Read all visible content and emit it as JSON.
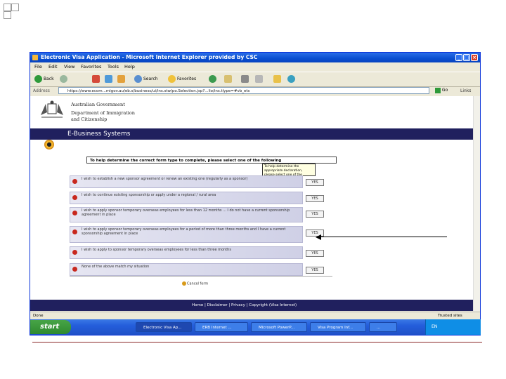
{
  "window": {
    "title": "Electronic Visa Application - Microsoft Internet Explorer provided by CSC"
  },
  "menu": {
    "items": [
      "File",
      "Edit",
      "View",
      "Favorites",
      "Tools",
      "Help"
    ]
  },
  "toolbar": {
    "back": "Back",
    "search": "Search",
    "favorites": "Favorites"
  },
  "address": {
    "label": "Address",
    "url": "https://www.ecom...migov.au/eb.s/business/ui/ins.stw/po.Selection.jsp?...lio/ins.tlype=#vb_ets",
    "go": "Go",
    "links": "Links"
  },
  "header": {
    "gov_line1": "Australian Government",
    "gov_line2": "Department of Immigration",
    "gov_line3": "and Citizenship",
    "banner": "E-Business Systems"
  },
  "form": {
    "prompt": "To help determine the correct form type to complete, please select one of the following",
    "tooltip": "To help determine the appropriate declaration, please select one of the following",
    "yes_label": "YES",
    "options": [
      "I wish to establish a new sponsor agreement or renew an existing one (regularly as a sponsor)",
      "I wish to continue existing sponsorship or apply under a regional / rural area",
      "I wish to apply sponsor temporary overseas employees for less than 12 months ... I do not have a current sponsorship agreement in place",
      "I wish to apply sponsor temporary overseas employees for a period of more than three months and I have a current sponsorship agreement in place",
      "I wish to apply to sponsor temporary overseas employees for less than three months",
      "None of the above match my situation"
    ],
    "cancel": "Cancel form"
  },
  "footer": {
    "text": "Home | Disclaimer | Privacy | Copyright (Visa Internet)"
  },
  "statusbar": {
    "left": "Done",
    "right": "Trusted sites"
  },
  "taskbar": {
    "start": "start",
    "tasks": [
      "Electronic Visa Ap...",
      "ERB Internet ...",
      "Microsoft PowerP...",
      "Visa Program Inf...",
      "..."
    ],
    "clock": "EN"
  }
}
